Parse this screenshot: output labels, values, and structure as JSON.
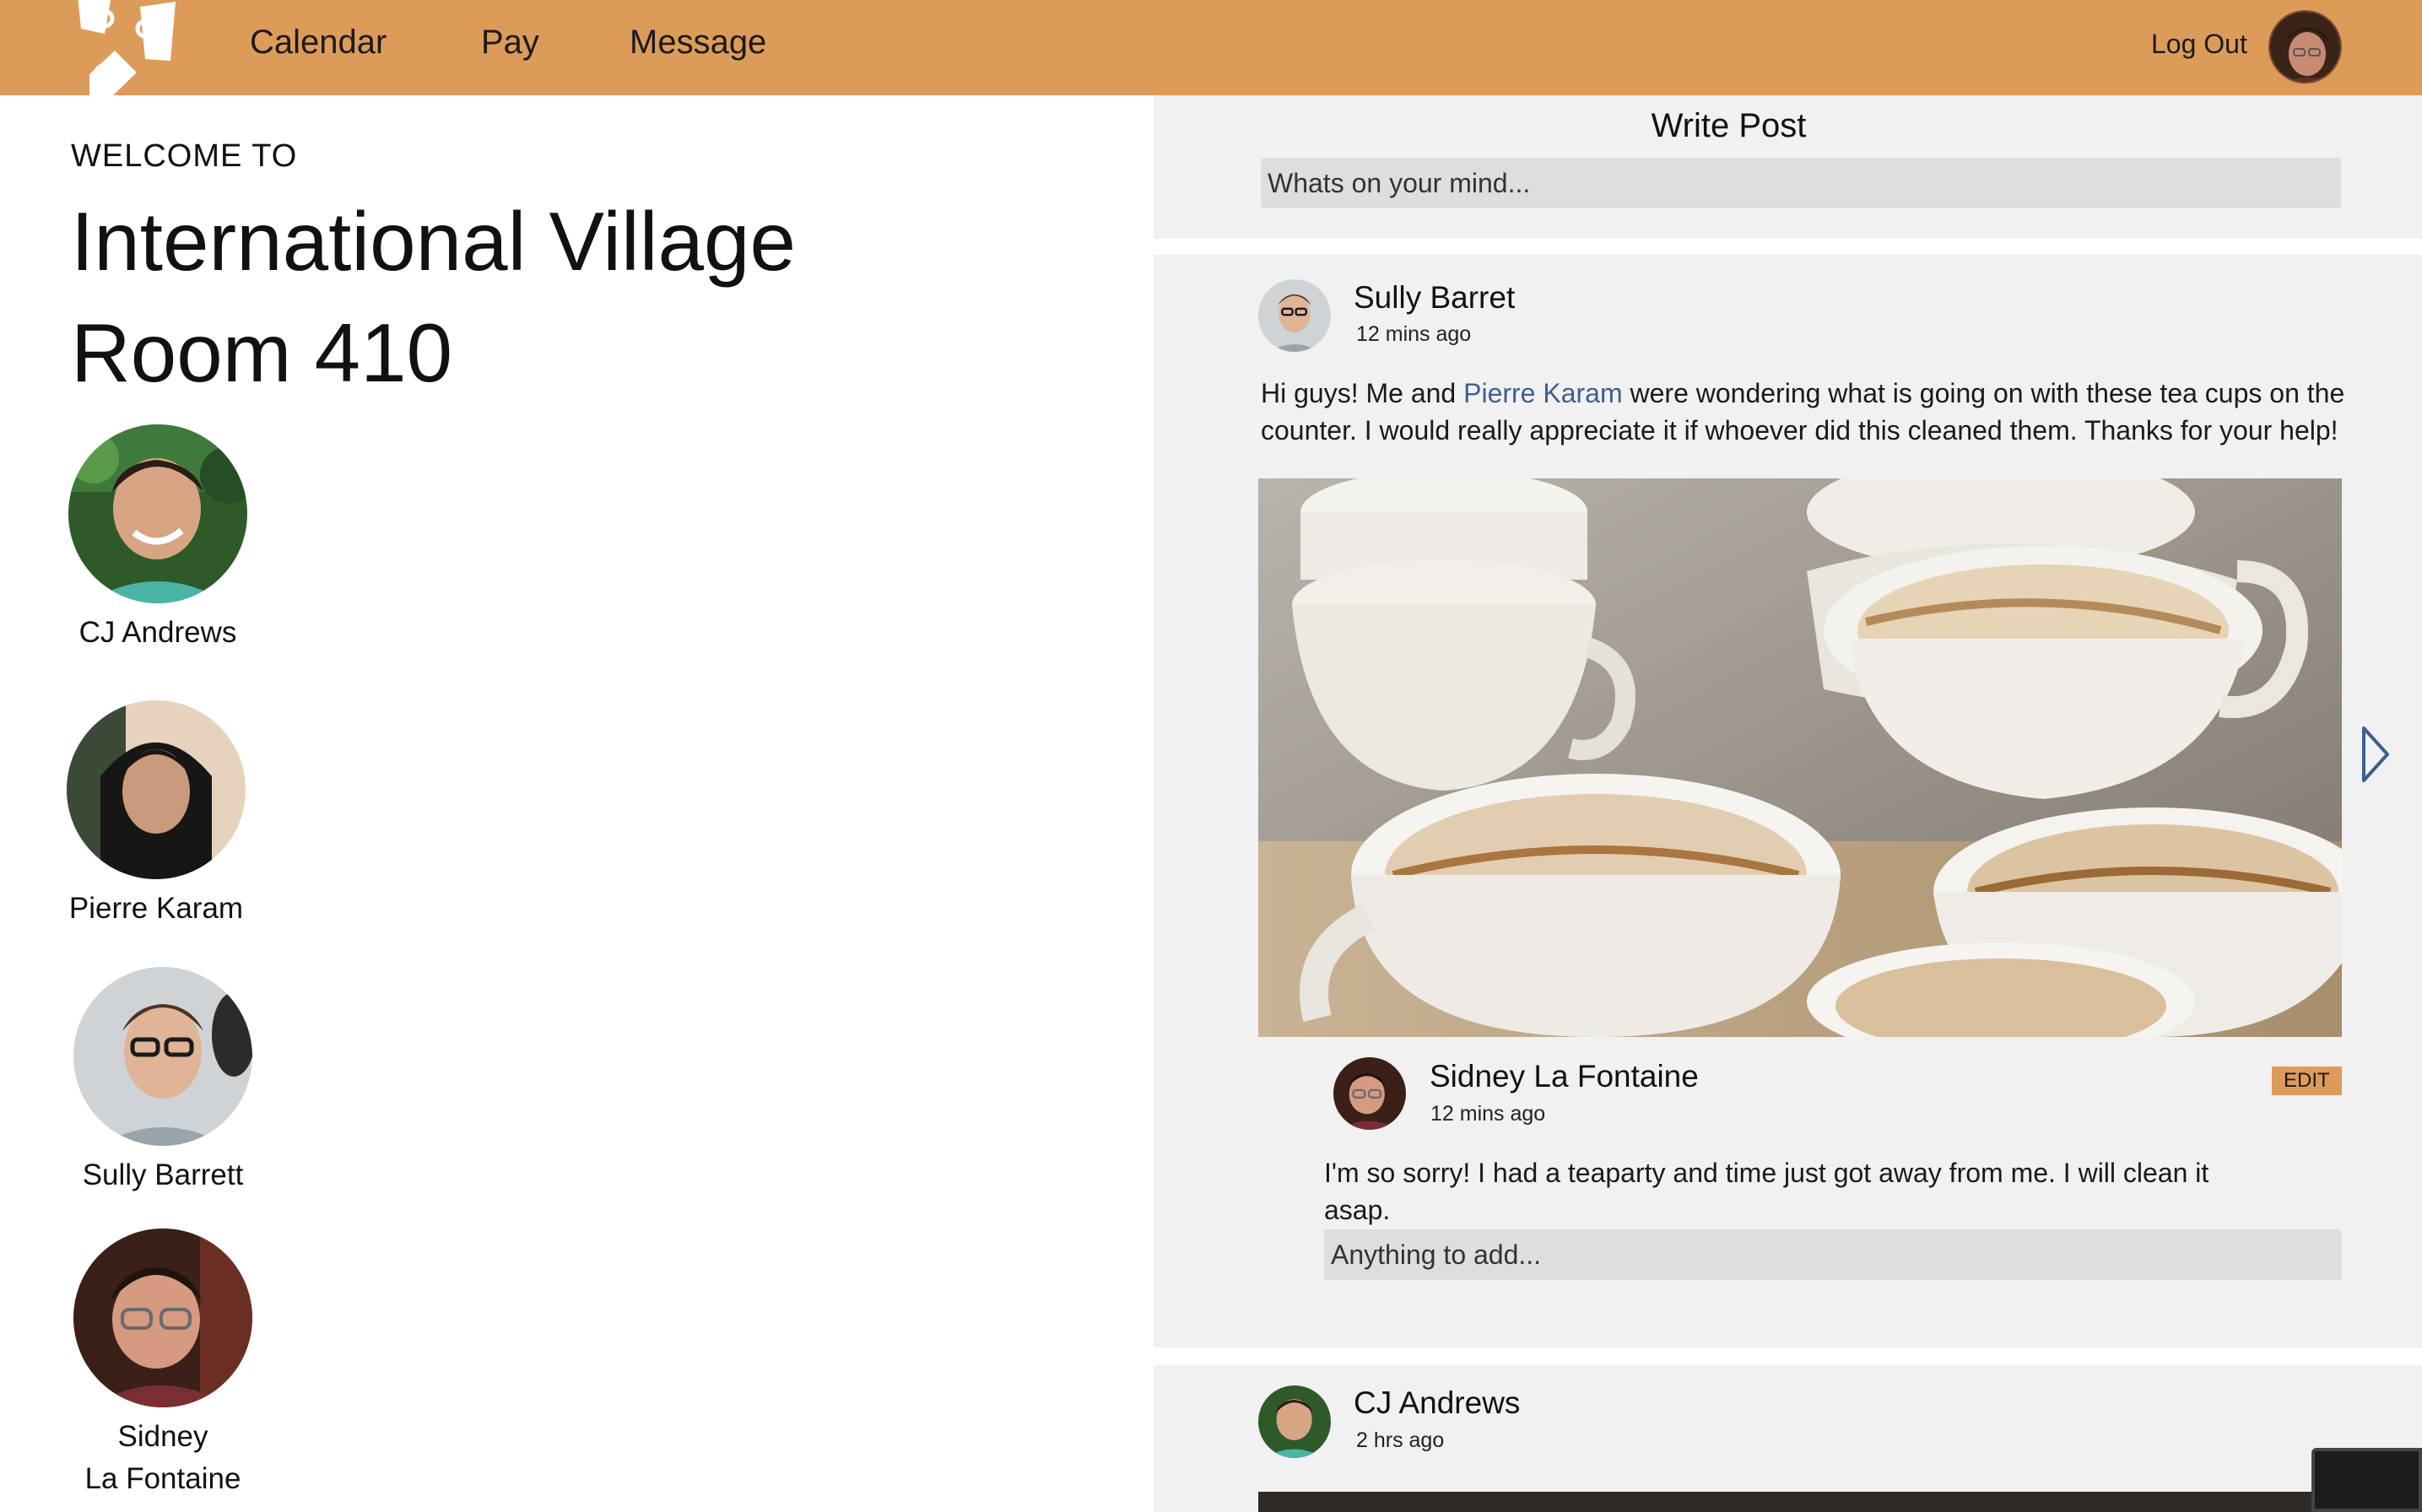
{
  "nav": {
    "calendar": "Calendar",
    "pay": "Pay",
    "message": "Message",
    "logout": "Log Out"
  },
  "colors": {
    "header": "#dd9b5a",
    "card": "#f1f1f1",
    "input": "#dedede",
    "mention": "#3d5f8f",
    "badge": "#dd9b5a"
  },
  "welcome": {
    "label": "WELCOME TO",
    "title_line1": "International Village",
    "title_line2": "Room 410"
  },
  "members": [
    {
      "name": "CJ Andrews"
    },
    {
      "name": "Pierre Karam"
    },
    {
      "name": "Sully Barrett"
    },
    {
      "name_line1": "Sidney",
      "name_line2": "La Fontaine"
    }
  ],
  "write_post": {
    "title": "Write Post",
    "placeholder": "Whats on your mind..."
  },
  "posts": [
    {
      "author": "Sully Barret",
      "time": "12 mins ago",
      "text_before": "Hi guys! Me and ",
      "mention": "Pierre Karam",
      "text_after": " were wondering what is going on with these tea cups on the counter. I would really appreciate it if whoever did this cleaned them. Thanks for your help!",
      "image": "tea-cups-photo",
      "comment": {
        "author": "Sidney La Fontaine",
        "time": "12 mins ago",
        "edit_label": "EDIT",
        "text": "I'm so sorry! I had a teaparty and time just got away from me. I will clean it asap."
      },
      "reply_placeholder": "Anything to add..."
    },
    {
      "author": "CJ Andrews",
      "time": "2 hrs ago"
    }
  ]
}
